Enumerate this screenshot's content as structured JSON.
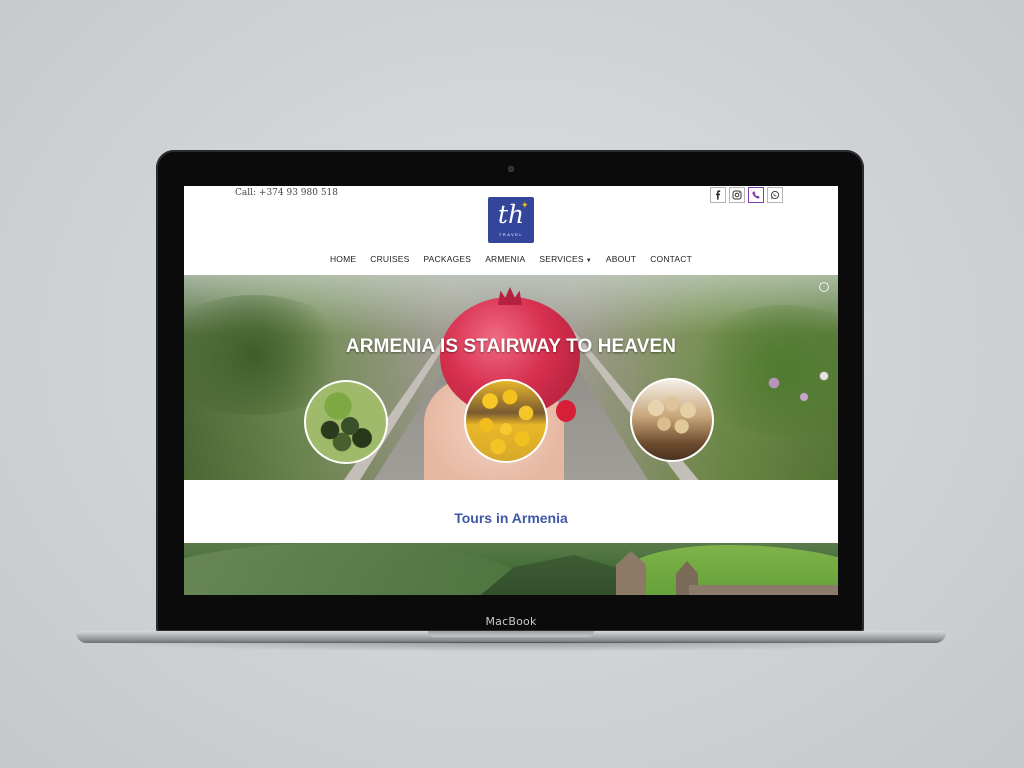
{
  "device": {
    "brand_label": "MacBook"
  },
  "header": {
    "call_text": "Call: +374 93 980 518",
    "logo": {
      "letters": "th",
      "subtitle": "TRAVEL",
      "bg_color": "#34469b",
      "accent_color": "#f2c21a"
    },
    "socials": [
      {
        "name": "facebook-icon",
        "glyph": "f"
      },
      {
        "name": "instagram-icon",
        "glyph": ""
      },
      {
        "name": "viber-icon",
        "glyph": ""
      },
      {
        "name": "whatsapp-icon",
        "glyph": ""
      }
    ]
  },
  "nav": {
    "items": [
      {
        "label": "HOME"
      },
      {
        "label": "CRUISES"
      },
      {
        "label": "PACKAGES"
      },
      {
        "label": "ARMENIA"
      },
      {
        "label": "SERVICES",
        "has_dropdown": true
      },
      {
        "label": "ABOUT"
      },
      {
        "label": "CONTACT"
      }
    ]
  },
  "hero": {
    "title": "ARMENIA IS STAIRWAY TO HEAVEN",
    "images": [
      "dolma-icon",
      "apricot-icon",
      "gata-bread-icon"
    ]
  },
  "tours": {
    "title": "Tours in Armenia",
    "title_color": "#3e58a6"
  }
}
